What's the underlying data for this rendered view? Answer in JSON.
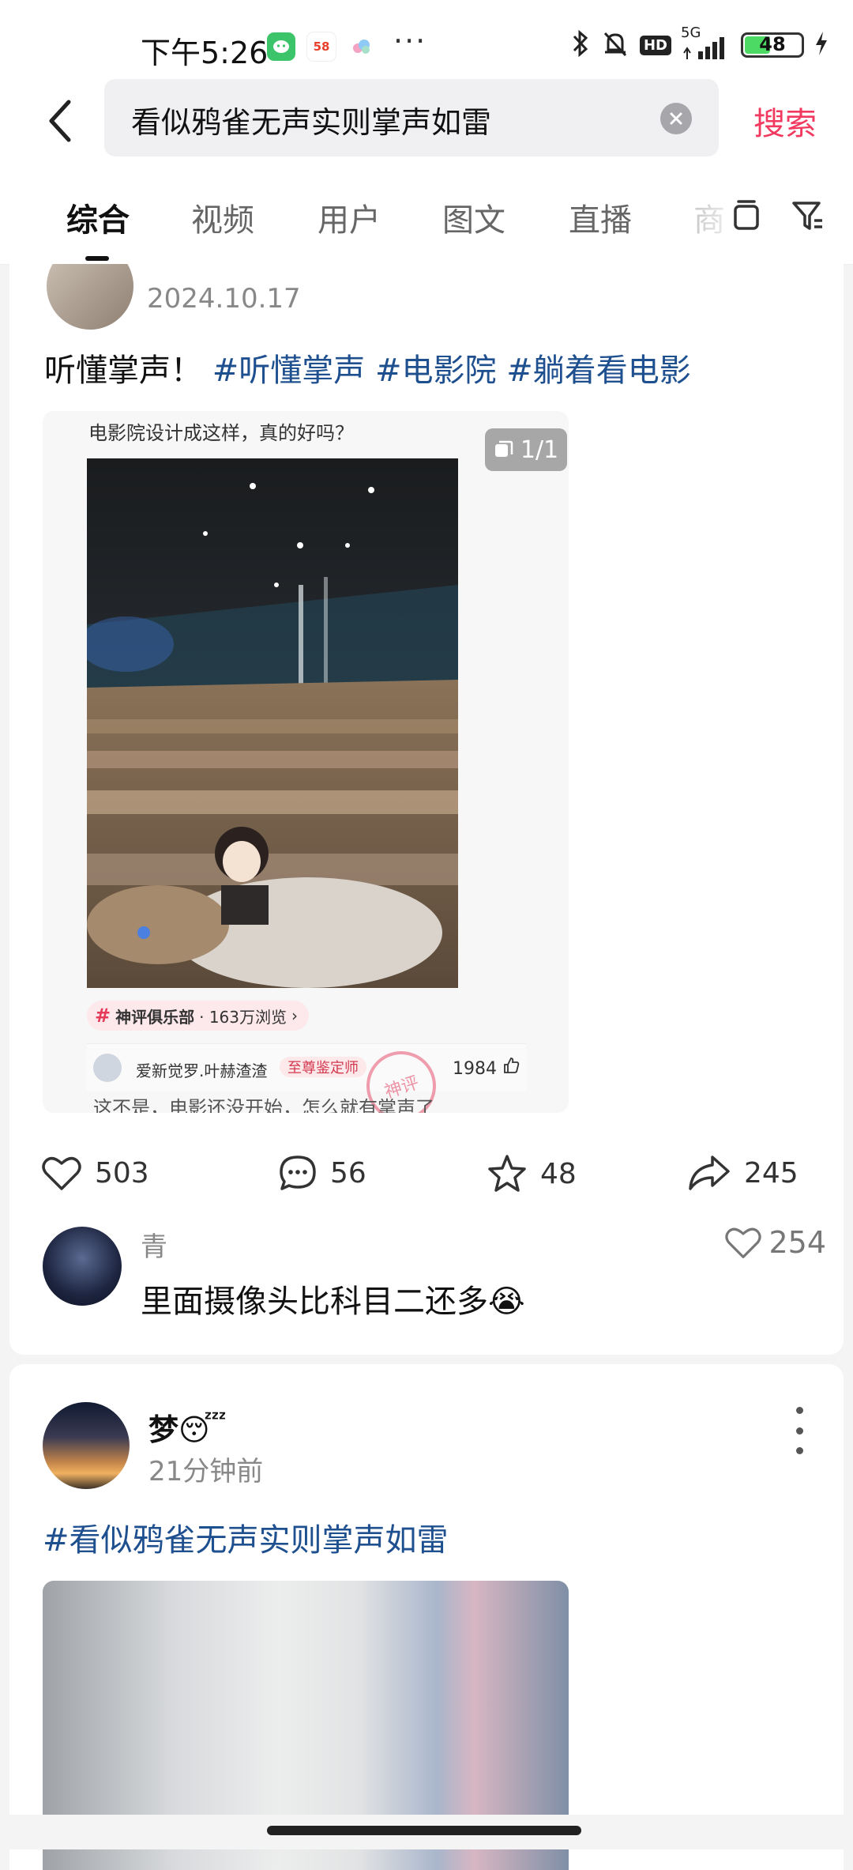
{
  "status_bar": {
    "time": "下午5:26",
    "app_icons": [
      "wechat-icon",
      "58-app-icon",
      "cloud-app-icon"
    ],
    "more": "···",
    "network": "5G",
    "hd": "HD",
    "battery": "48",
    "battery_level": 0.48
  },
  "header": {
    "search_query": "看似鸦雀无声实则掌声如雷",
    "search_button": "搜索"
  },
  "tabs": [
    {
      "label": "综合",
      "active": true
    },
    {
      "label": "视频"
    },
    {
      "label": "用户"
    },
    {
      "label": "图文"
    },
    {
      "label": "直播"
    },
    {
      "label": "商"
    }
  ],
  "post1": {
    "date": "2024.10.17",
    "text": "听懂掌声！",
    "hashtags": [
      "#听懂掌声",
      "#电影院",
      "#躺着看电影"
    ],
    "image": {
      "title": "电影院设计成这样，真的好吗？",
      "count": "1/1",
      "club_name": "神评俱乐部",
      "club_views": "· 163万浏览",
      "comment_user": "爱新觉罗.叶赫渣渣",
      "comment_badge": "至尊鉴定师",
      "comment_likes": "1984",
      "stamp": "神评",
      "cut_text": "这不是，电影还没开始，怎么就有掌声了"
    },
    "actions": {
      "likes": "503",
      "comments": "56",
      "favorites": "48",
      "shares": "245"
    },
    "top_comment": {
      "user": "青",
      "text": "里面摄像头比科目二还多",
      "emoji": "😭",
      "likes": "254"
    }
  },
  "post2": {
    "user": "梦",
    "emoji": "😴",
    "time": "21分钟前",
    "hashtag": "#看似鸦雀无声实则掌声如雷"
  },
  "colors": {
    "accent": "#f2395f",
    "hashtag": "#1e4f8f",
    "battery": "#4cd964"
  }
}
